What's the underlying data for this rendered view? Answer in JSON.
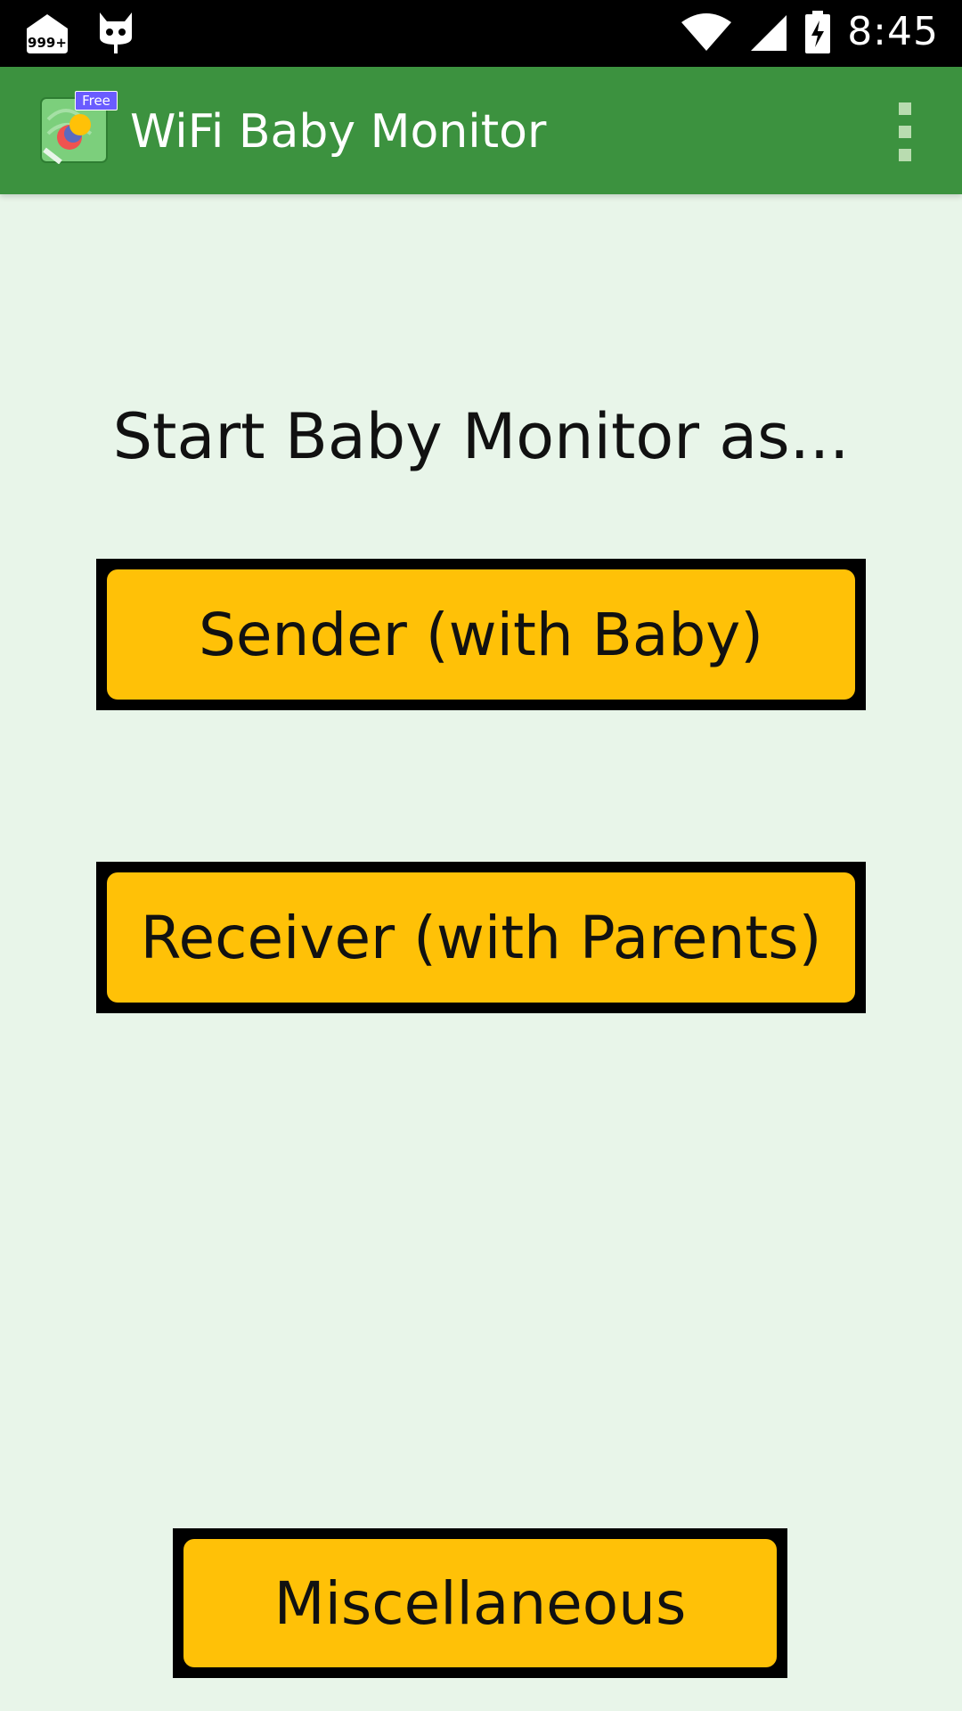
{
  "status_bar": {
    "notification_count": "999+",
    "time": "8:45",
    "icons": [
      "mail-notification-icon",
      "cyanogen-mascot-icon",
      "wifi-icon",
      "cell-signal-icon",
      "battery-charging-icon"
    ]
  },
  "app_bar": {
    "title": "WiFi Baby Monitor",
    "badge": "Free",
    "logo_icon": "app-logo-icon",
    "menu_icon": "overflow-menu-icon",
    "color": "#3c923f"
  },
  "main": {
    "prompt": "Start Baby Monitor as...",
    "sender_label": "Sender (with Baby)",
    "receiver_label": "Receiver (with Parents)",
    "misc_label": "Miscellaneous",
    "background": "#e8f5e9",
    "button_color": "#ffc107"
  }
}
